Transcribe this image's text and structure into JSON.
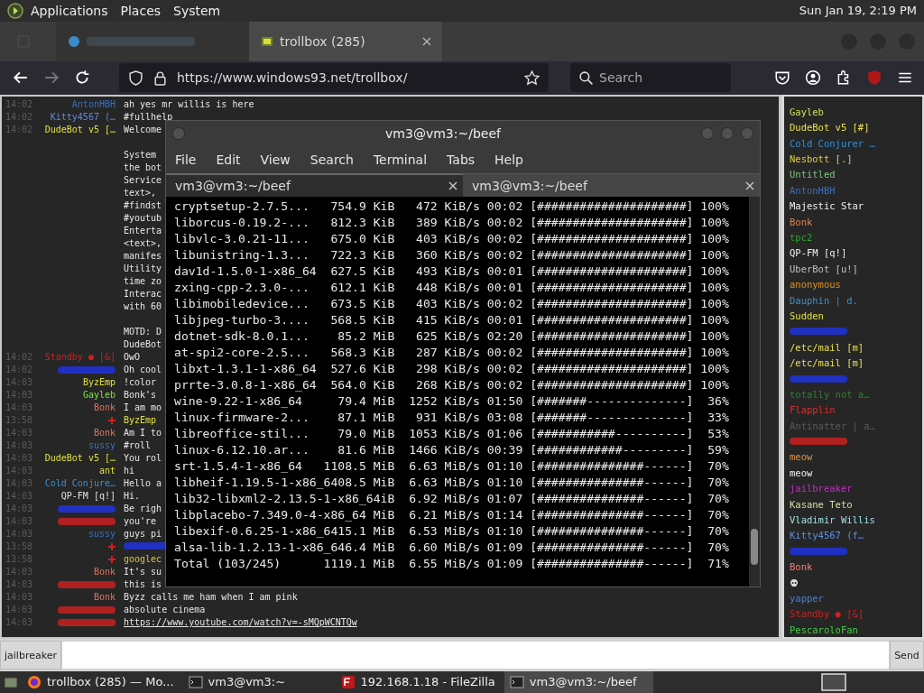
{
  "top_panel": {
    "menus": [
      "Applications",
      "Places",
      "System"
    ],
    "clock": "Sun Jan 19, 2:19 PM"
  },
  "browser_tabs": [
    {
      "kind": "blurred",
      "selected": false
    },
    {
      "kind": "page",
      "label": "trollbox (285)",
      "selected": true
    }
  ],
  "nav": {
    "forward_enabled": false,
    "url": "https://www.windows93.net/trollbox/",
    "search_placeholder": "Search"
  },
  "chat": [
    {
      "kind": "msg",
      "time": "14:02",
      "nick": "AntonHBH",
      "color": "#3a70c0",
      "text": "ah yes mr willis is here"
    },
    {
      "kind": "msg",
      "time": "14:02",
      "nick": "Kitty4567 (…",
      "color": "#5a8ae0",
      "text": "#fullhelp"
    },
    {
      "kind": "msg",
      "time": "14:02",
      "nick": "DudeBot v5 […",
      "color": "#e0e040",
      "text": "Welcome"
    },
    {
      "kind": "gap"
    },
    {
      "kind": "cont",
      "text": "System"
    },
    {
      "kind": "cont",
      "text": "the bot"
    },
    {
      "kind": "cont",
      "text": "Service"
    },
    {
      "kind": "cont",
      "text": "text>,"
    },
    {
      "kind": "cont",
      "text": "#findst"
    },
    {
      "kind": "cont",
      "text": "#youtub"
    },
    {
      "kind": "cont",
      "text": "Enterta"
    },
    {
      "kind": "cont",
      "text": "<text>,"
    },
    {
      "kind": "cont",
      "text": "manifes"
    },
    {
      "kind": "cont",
      "text": "Utility"
    },
    {
      "kind": "cont",
      "text": "time zo"
    },
    {
      "kind": "cont",
      "text": "Interac"
    },
    {
      "kind": "cont",
      "text": "with 60"
    },
    {
      "kind": "gap"
    },
    {
      "kind": "cont",
      "text": "MOTD: D"
    },
    {
      "kind": "cont",
      "text": "DudeBot"
    },
    {
      "kind": "msg",
      "time": "14:02",
      "nick": "Standby ● [&]",
      "color": "#d02020",
      "text": "OwO"
    },
    {
      "kind": "hidden",
      "time": "14:02",
      "color": "#2030c0",
      "text": "Oh cool"
    },
    {
      "kind": "msg",
      "time": "14:03",
      "nick": "ByzEmp",
      "color": "#e0e040",
      "text": "!color"
    },
    {
      "kind": "msg",
      "time": "14:03",
      "nick": "Gayleb",
      "color": "#80e040",
      "text": "Bonk's"
    },
    {
      "kind": "msg",
      "time": "14:03",
      "nick": "Bonk",
      "color": "#e07060",
      "text": "I am mo"
    },
    {
      "kind": "action",
      "time": "13:58",
      "color": "#e0e040",
      "text": "ByzEmp"
    },
    {
      "kind": "msg",
      "time": "14:03",
      "nick": "Bonk",
      "color": "#e07060",
      "text": "Am I to"
    },
    {
      "kind": "msg",
      "time": "14:03",
      "nick": "sussy",
      "color": "#3a70c0",
      "text": "#roll"
    },
    {
      "kind": "msg",
      "time": "14:03",
      "nick": "DudeBot v5 […",
      "color": "#e0e040",
      "text": "You rol"
    },
    {
      "kind": "msg",
      "time": "14:03",
      "nick": "ant",
      "color": "#e0e040",
      "text": "hi"
    },
    {
      "kind": "msg",
      "time": "14:03",
      "nick": "Cold Conjure…",
      "color": "#3a90d0",
      "text": "Hello a"
    },
    {
      "kind": "msg",
      "time": "14:03",
      "nick": "QP-FM [q!]",
      "color": "#e0e0e0",
      "text": "Hi."
    },
    {
      "kind": "hidden",
      "time": "14:03",
      "color": "#2030c0",
      "text": "Be righ"
    },
    {
      "kind": "hidden",
      "time": "14:03",
      "color": "#b02020",
      "text": "you're"
    },
    {
      "kind": "msg",
      "time": "14:03",
      "nick": "sussy",
      "color": "#3a70c0",
      "text": "guys pi"
    },
    {
      "kind": "hidden_action",
      "time": "13:58",
      "color": "#2030c0"
    },
    {
      "kind": "action",
      "time": "13:58",
      "color": "#e0c040",
      "text": "googlec"
    },
    {
      "kind": "msg",
      "time": "14:03",
      "nick": "Bonk",
      "color": "#e07060",
      "text": "It's su"
    },
    {
      "kind": "hidden",
      "time": "14:03",
      "color": "#b02020",
      "text": "this is"
    },
    {
      "kind": "msg",
      "time": "14:03",
      "nick": "Bonk",
      "color": "#e07060",
      "text": "Byzz calls me ham when I am pink"
    },
    {
      "kind": "hidden",
      "time": "14:03",
      "color": "#b02020",
      "text": "absolute cinema"
    },
    {
      "kind": "hidden",
      "time": "14:03",
      "color": "#b02020",
      "text": "https://www.youtube.com/watch?v=-sMQpWCNTQw",
      "link": true
    }
  ],
  "users": [
    {
      "kind": "name",
      "name": "Gayleb",
      "color": "#c8e060"
    },
    {
      "kind": "name",
      "name": "DudeBot v5 [#]",
      "color": "#e8e050"
    },
    {
      "kind": "name",
      "name": "Cold Conjurer …",
      "color": "#3a8fd0"
    },
    {
      "kind": "name",
      "name": "Nesbott [.]",
      "color": "#e0d040"
    },
    {
      "kind": "name",
      "name": "Untitled",
      "color": "#80c080"
    },
    {
      "kind": "name",
      "name": "AntonHBH",
      "color": "#3a70c0"
    },
    {
      "kind": "name",
      "name": "Majestic Star",
      "color": "#f0f0f0"
    },
    {
      "kind": "name",
      "name": "Bonk",
      "color": "#e08050"
    },
    {
      "kind": "name",
      "name": "tpc2",
      "color": "#30a030"
    },
    {
      "kind": "name",
      "name": "QP-FM [q!]",
      "color": "#f0f0f0"
    },
    {
      "kind": "name",
      "name": "UberBot [u!]",
      "color": "#c0c0c0"
    },
    {
      "kind": "name",
      "name": "anonymous",
      "color": "#e09020"
    },
    {
      "kind": "name",
      "name": "Dauphin | d.",
      "color": "#3a90d0"
    },
    {
      "kind": "name",
      "name": "Sudden",
      "color": "#e0e040"
    },
    {
      "kind": "hidden",
      "color": "#2030c0"
    },
    {
      "kind": "name",
      "name": "/etc/mail [m]",
      "color": "#e8e050"
    },
    {
      "kind": "name",
      "name": "/etc/mail [m]",
      "color": "#e8e050"
    },
    {
      "kind": "hidden",
      "color": "#2030c0"
    },
    {
      "kind": "name",
      "name": "totally not a…",
      "color": "#308030"
    },
    {
      "kind": "name",
      "name": "Flapplin",
      "color": "#d03030"
    },
    {
      "kind": "name",
      "name": "Antinatter | a…",
      "color": "#5a5a5a"
    },
    {
      "kind": "hidden",
      "color": "#b02020"
    },
    {
      "kind": "name",
      "name": "meow",
      "color": "#e09040"
    },
    {
      "kind": "name",
      "name": "meow",
      "color": "#f0f0f0"
    },
    {
      "kind": "name",
      "name": "jailbreaker",
      "color": "#c030c0"
    },
    {
      "kind": "name",
      "name": "Kasane Teto",
      "color": "#d0e0a0"
    },
    {
      "kind": "name",
      "name": "Vladimir Willis",
      "color": "#a0e0e0"
    },
    {
      "kind": "name",
      "name": "Kitty4567 (f…",
      "color": "#6090e0"
    },
    {
      "kind": "hidden",
      "color": "#2030c0"
    },
    {
      "kind": "name",
      "name": "Bonk",
      "color": "#f08070"
    },
    {
      "kind": "skull",
      "color": "#e0e0e0"
    },
    {
      "kind": "name",
      "name": "yapper",
      "color": "#4a80d0"
    },
    {
      "kind": "name",
      "name": "Standby ● [&]",
      "color": "#d02020"
    },
    {
      "kind": "name",
      "name": "PescaroloFan",
      "color": "#40d040"
    }
  ],
  "input_row": {
    "nick": "jailbreaker",
    "send": "Send"
  },
  "terminal": {
    "title": "vm3@vm3:~/beef",
    "menus": [
      "File",
      "Edit",
      "View",
      "Search",
      "Terminal",
      "Tabs",
      "Help"
    ],
    "tabs": [
      {
        "label": "vm3@vm3:~/beef",
        "selected": true
      },
      {
        "label": "vm3@vm3:~/beef",
        "selected": false
      }
    ],
    "lines": [
      "cryptsetup-2.7.5...   754.9 KiB   472 KiB/s 00:02 [#####################] 100%",
      "liborcus-0.19.2-...   812.3 KiB   389 KiB/s 00:02 [#####################] 100%",
      "libvlc-3.0.21-11...   675.0 KiB   403 KiB/s 00:02 [#####################] 100%",
      "libunistring-1.3...   722.3 KiB   360 KiB/s 00:02 [#####################] 100%",
      "dav1d-1.5.0-1-x86_64  627.5 KiB   493 KiB/s 00:01 [#####################] 100%",
      "zxing-cpp-2.3.0-...   612.1 KiB   448 KiB/s 00:01 [#####################] 100%",
      "libimobiledevice...   673.5 KiB   403 KiB/s 00:02 [#####################] 100%",
      "libjpeg-turbo-3....   568.5 KiB   415 KiB/s 00:01 [#####################] 100%",
      "dotnet-sdk-8.0.1...    85.2 MiB   625 KiB/s 02:20 [#####################] 100%",
      "at-spi2-core-2.5...   568.3 KiB   287 KiB/s 00:02 [#####################] 100%",
      "libxt-1.3.1-1-x86_64  527.6 KiB   298 KiB/s 00:02 [#####################] 100%",
      "prrte-3.0.8-1-x86_64  564.0 KiB   268 KiB/s 00:02 [#####################] 100%",
      "wine-9.22-1-x86_64     79.4 MiB  1252 KiB/s 01:50 [#######--------------]  36%",
      "linux-firmware-2...    87.1 MiB   931 KiB/s 03:08 [#######--------------]  33%",
      "libreoffice-stil...    79.0 MiB  1053 KiB/s 01:06 [###########----------]  53%",
      "linux-6.12.10.ar...    81.6 MiB  1466 KiB/s 00:39 [############---------]  59%",
      "srt-1.5.4-1-x86_64   1108.5 MiB  6.63 MiB/s 01:10 [###############------]  70%",
      "libheif-1.19.5-1-x86_6408.5 MiB  6.63 MiB/s 01:10 [###############------]  70%",
      "lib32-libxml2-2.13.5-1-x86_64iB  6.92 MiB/s 01:07 [###############------]  70%",
      "libplacebo-7.349.0-4-x86_64 MiB  6.21 MiB/s 01:14 [###############------]  70%",
      "libexif-0.6.25-1-x86_6415.1 MiB  6.53 MiB/s 01:10 [###############------]  70%",
      "alsa-lib-1.2.13-1-x86_646.4 MiB  6.60 MiB/s 01:09 [###############------]  70%",
      "Total (103/245)      1119.1 MiB  6.55 MiB/s 01:09 [###############------]  71%"
    ]
  },
  "taskbar": {
    "items": [
      {
        "kind": "firefox",
        "label": "trollbox (285) — Mo...",
        "selected": false
      },
      {
        "kind": "terminal",
        "label": "vm3@vm3:~",
        "selected": false
      },
      {
        "kind": "filezilla",
        "label": "192.168.1.18 - FileZilla",
        "selected": false
      },
      {
        "kind": "terminal",
        "label": "vm3@vm3:~/beef",
        "selected": true
      }
    ]
  }
}
